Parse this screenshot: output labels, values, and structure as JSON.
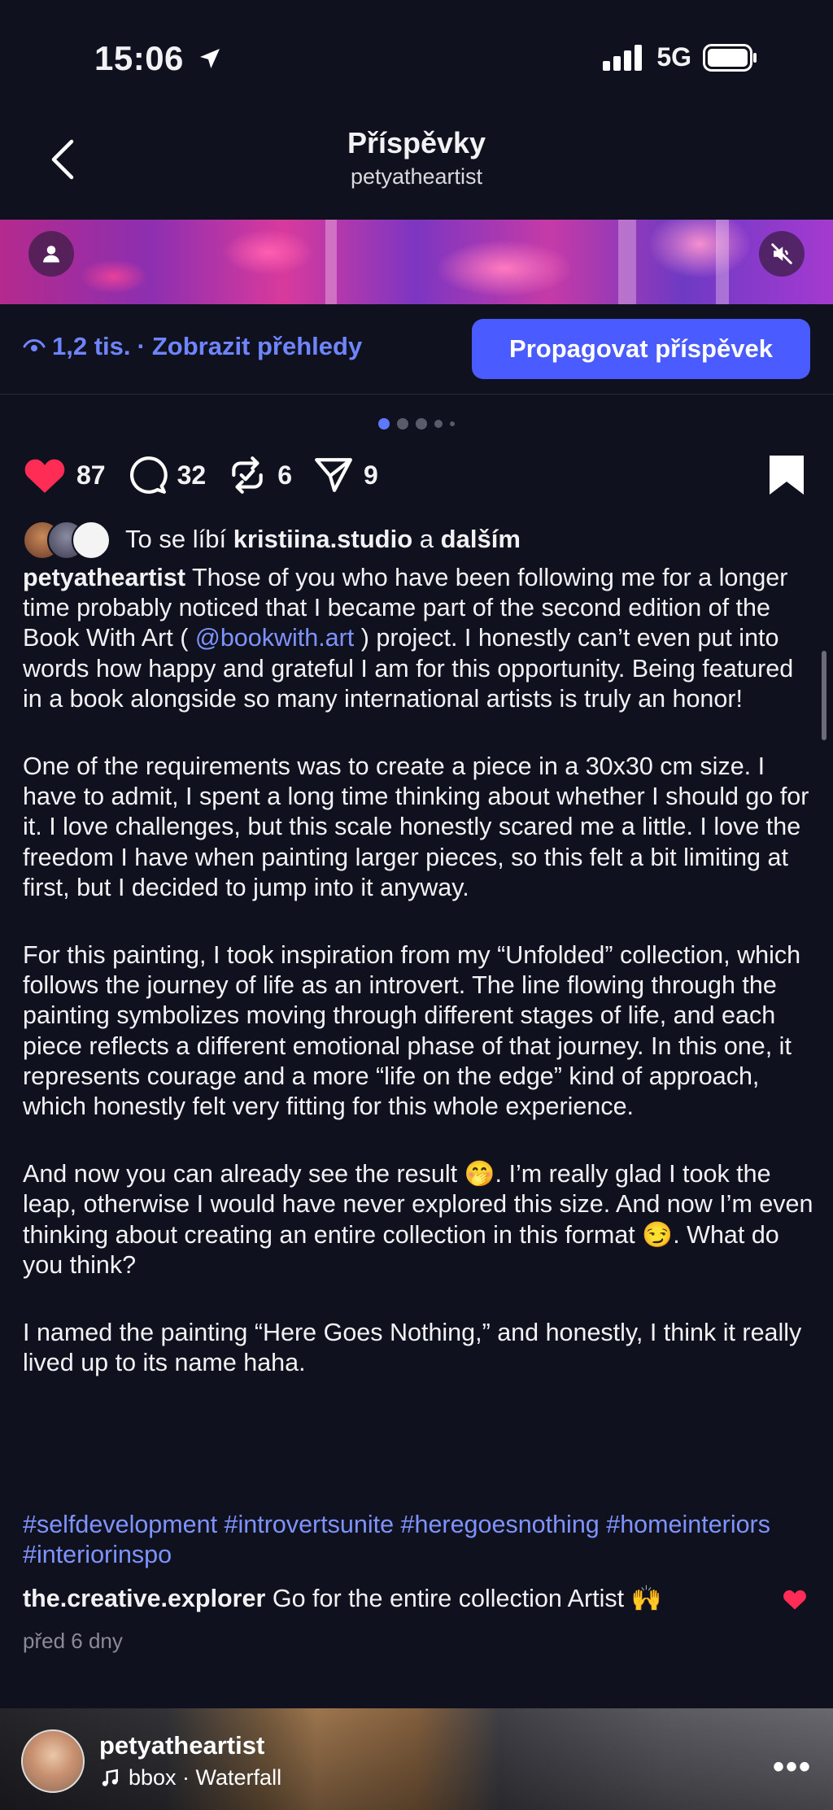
{
  "status_bar": {
    "time": "15:06",
    "network": "5G"
  },
  "header": {
    "title": "Příspěvky",
    "subtitle": "petyatheartist"
  },
  "insights": {
    "views": "1,2 tis.",
    "separator": "·",
    "link": "Zobrazit přehledy"
  },
  "promote_button": "Propagovat příspěvek",
  "carousel": {
    "total": 5,
    "active": 1
  },
  "actions": {
    "likes": "87",
    "comments": "32",
    "reposts": "6",
    "shares": "9"
  },
  "liked_by": {
    "prefix": "To se líbí",
    "user": "kristiina.studio",
    "joiner": "a",
    "others": "dalším"
  },
  "caption": {
    "author": "petyatheartist",
    "p1_a": "Those of you who have been following me for a longer time probably noticed that I became part of the second edition of the Book With Art (",
    "p1_mention": "@bookwith.art",
    "p1_b": ") project. I honestly can’t even put into words how happy and grateful I am for this opportunity. Being featured in a book alongside so many international artists is truly an honor!",
    "p2": "One of the requirements was to create a piece in a 30x30 cm size. I have to admit, I spent a long time thinking about whether I should go for it. I love challenges, but this scale honestly scared me a little. I love the freedom I have when painting larger pieces, so this felt a bit limiting at first, but I decided to jump into it anyway.",
    "p3": "For this painting, I took inspiration from my “Unfolded” collection, which follows the journey of life as an introvert. The line flowing through the painting symbolizes moving through different stages of life, and each piece reflects a different emotional phase of that journey. In this one, it represents courage and a more “life on the edge” kind of approach, which honestly felt very fitting for this whole experience.",
    "p4_a": "And now you can already see the result 🤭. I’m really glad I took the leap, otherwise I would have never explored this size. And now I’m even thinking about creating an entire collection in this format 😏. What do you think?",
    "p5": "I named the painting “Here Goes Nothing,” and honestly, I think it really lived up to its name haha."
  },
  "hashtags": "#selfdevelopment #introvertsunite #heregoesnothing #homeinteriors #interiorinspo",
  "top_comment": {
    "user": "the.creative.explorer",
    "text": "Go for the entire collection Artist 🙌"
  },
  "posted": "před 6 dny",
  "next_post": {
    "user": "petyatheartist",
    "track": "bbox · Waterfall"
  },
  "colors": {
    "background": "#10111e",
    "accent": "#4a5cff",
    "link": "#7e93ff",
    "like": "#ff2d55"
  }
}
